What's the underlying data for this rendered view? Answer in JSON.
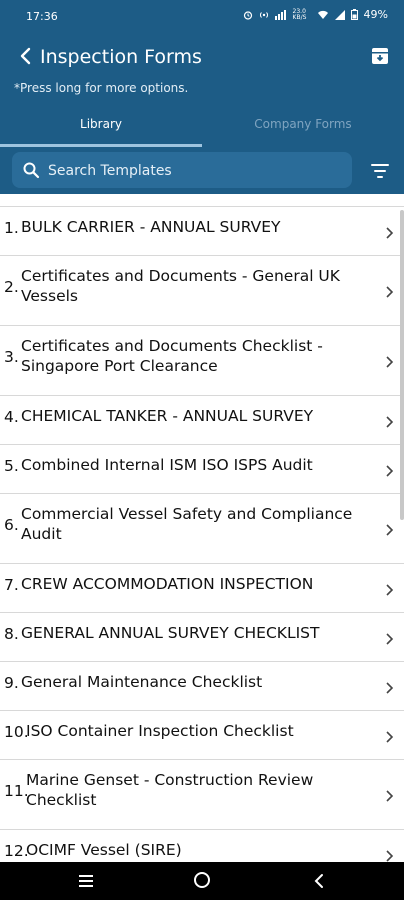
{
  "status_bar": {
    "time": "17:36",
    "network": "23.0 KB/S",
    "battery": "49%"
  },
  "header": {
    "title": "Inspection Forms",
    "hint": "*Press long for more options.",
    "tabs": [
      {
        "label": "Library",
        "active": true
      },
      {
        "label": "Company Forms",
        "active": false
      }
    ]
  },
  "search": {
    "placeholder": "Search Templates"
  },
  "forms": [
    {
      "number": "1.",
      "label": "BULK CARRIER - ANNUAL SURVEY"
    },
    {
      "number": "2.",
      "label": "Certificates and Documents - General UK Vessels"
    },
    {
      "number": "3.",
      "label": "Certificates and Documents Checklist -Singapore Port Clearance"
    },
    {
      "number": "4.",
      "label": "CHEMICAL TANKER - ANNUAL SURVEY"
    },
    {
      "number": "5.",
      "label": "Combined Internal ISM ISO ISPS Audit"
    },
    {
      "number": "6.",
      "label": "Commercial Vessel Safety and Compliance Audit"
    },
    {
      "number": "7.",
      "label": "CREW ACCOMMODATION INSPECTION"
    },
    {
      "number": "8.",
      "label": "GENERAL ANNUAL SURVEY CHECKLIST"
    },
    {
      "number": "9.",
      "label": "General Maintenance Checklist"
    },
    {
      "number": "10.",
      "label": "ISO Container Inspection Checklist"
    },
    {
      "number": "11.",
      "label": "Marine Genset - Construction Review Checklist"
    },
    {
      "number": "12.",
      "label": "OCIMF Vessel (SIRE)"
    }
  ],
  "colors": {
    "header_bg": "#1d5c86",
    "search_bg": "#2a6c99",
    "tab_active": "#ffffff",
    "tab_inactive": "#7fa4c0"
  }
}
